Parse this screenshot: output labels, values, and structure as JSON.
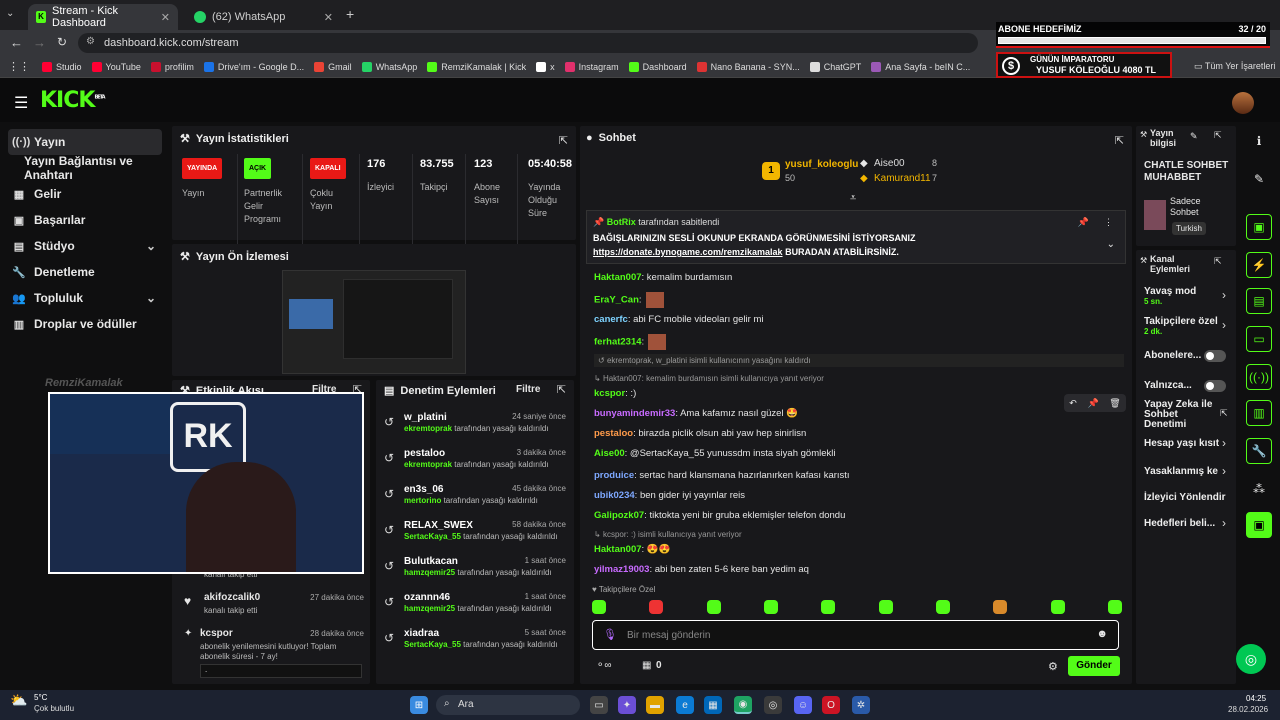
{
  "browser": {
    "tabs": [
      {
        "label": "Stream - Kick Dashboard"
      },
      {
        "label": "(62) WhatsApp"
      }
    ],
    "url": "dashboard.kick.com/stream",
    "bookmarks": [
      "Studio",
      "YouTube",
      "profilim",
      "Drive'ım - Google D...",
      "Gmail",
      "WhatsApp",
      "RemziKamalak | Kick",
      "x",
      "Instagram",
      "Dashboard",
      "Nano Banana - SYN...",
      "ChatGPT",
      "Ana Sayfa - beIN C..."
    ],
    "all_bookmarks": "Tüm Yer İşaretleri"
  },
  "overlay": {
    "goal_title": "ABONE HEDEFİMİZ",
    "goal_count": "32 / 20",
    "goal_progress": 1.0,
    "emperor_title": "GÜNÜN İMPARATORU",
    "emperor_value": "YUSUF KÖLEOĞLU 4080 TL"
  },
  "kick": {
    "logo": "KICK",
    "beta": "BETA"
  },
  "sidebar": {
    "items": [
      {
        "label": "Yayın"
      },
      {
        "label": "Yayın Bağlantısı ve Anahtarı"
      },
      {
        "label": "Gelir"
      },
      {
        "label": "Başarılar"
      },
      {
        "label": "Stüdyo"
      },
      {
        "label": "Denetleme"
      },
      {
        "label": "Topluluk"
      },
      {
        "label": "Droplar ve ödüller"
      }
    ]
  },
  "stats": {
    "title": "Yayın İstatistikleri",
    "items": [
      {
        "badge": "YAYINDA",
        "label": "Yayın"
      },
      {
        "badge": "AÇIK",
        "label": "Partnerlik Gelir Programı"
      },
      {
        "badge": "KAPALI",
        "label": "Çoklu Yayın"
      },
      {
        "value": "176",
        "label": "İzleyici"
      },
      {
        "value": "83.755",
        "label": "Takipçi"
      },
      {
        "value": "123",
        "label": "Abone Sayısı"
      },
      {
        "value": "05:40:58",
        "label": "Yayında Olduğu Süre"
      }
    ]
  },
  "preview": {
    "title": "Yayın Ön İzlemesi"
  },
  "webcam_name": "RemziKamalak",
  "activity": {
    "title": "Etkinlik Akışı",
    "filter": "Filtre",
    "items": [
      {
        "sub": "kanalı takip etti"
      },
      {
        "user": "akifozcalik0",
        "time": "27 dakika önce",
        "sub": "kanalı takip etti"
      },
      {
        "user": "kcspor",
        "time": "28 dakika önce",
        "sub": "abonelik yenilemesini kutluyor! Toplam abonelik süresi - 7 ay!",
        "extra": "."
      }
    ]
  },
  "modlog": {
    "title": "Denetim Eylemleri",
    "filter": "Filtre",
    "items": [
      {
        "user": "w_platini",
        "time": "24 saniye önce",
        "by": "ekremtoprak",
        "desc": "tarafından yasağı kaldırıldı"
      },
      {
        "user": "pestaloo",
        "time": "3 dakika önce",
        "by": "ekremtoprak",
        "desc": "tarafından yasağı kaldırıldı"
      },
      {
        "user": "en3s_06",
        "time": "45 dakika önce",
        "by": "mertorino",
        "desc": "tarafından yasağı kaldırıldı"
      },
      {
        "user": "RELAX_SWEX",
        "time": "58 dakika önce",
        "by": "SertacKaya_55",
        "desc": "tarafından yasağı kaldırıldı"
      },
      {
        "user": "Bulutkacan",
        "time": "1 saat önce",
        "by": "hamzqemir25",
        "desc": "tarafından yasağı kaldırıldı"
      },
      {
        "user": "ozannn46",
        "time": "1 saat önce",
        "by": "hamzqemir25",
        "desc": "tarafından yasağı kaldırıldı"
      },
      {
        "user": "xiadraa",
        "time": "5 saat önce",
        "by": "SertacKaya_55",
        "desc": "tarafından yasağı kaldırıldı"
      }
    ]
  },
  "chat": {
    "title": "Sohbet",
    "top": [
      {
        "name": "yusuf_koleoglu",
        "count": "50",
        "rank": "1"
      },
      {
        "name": "Aise00",
        "count": "8"
      },
      {
        "name": "Kamurand11",
        "count": "7"
      }
    ],
    "pinned_by": "tarafından sabitlendi",
    "pinned_user": "BotRix",
    "pinned_text1": "BAĞIŞLARINIZIN SESLİ OKUNUP EKRANDA GÖRÜNMESİNİ İSTİYORSANIZ",
    "pinned_link": "https://donate.bynogame.com/remzikamalak",
    "pinned_text2": " BURADAN ATABİLİRSİNİZ.",
    "messages": [
      {
        "user": "Haktan007",
        "text": ": kemalim burdamısın",
        "color": "#53fc18"
      },
      {
        "user": "EraY_Can",
        "text": ":",
        "color": "#53fc18"
      },
      {
        "user": "canerfc",
        "text": ": abi FC mobile videoları gelir mi",
        "color": "#7ed3ff"
      },
      {
        "user": "ferhat2314",
        "text": ":",
        "color": "#53fc18"
      },
      {
        "sys": "ekremtoprak, w_platini isimli kullanıcının yasağını kaldırdı"
      },
      {
        "reply": "Haktan007: kemalim burdamısın isimli kullanıcıya yanıt veriyor"
      },
      {
        "user": "kcspor",
        "text": ": :)",
        "color": "#53fc18"
      },
      {
        "user": "bunyamindemir33",
        "text": ": Ama kafamız nasıl güzel 🤩",
        "color": "#c86bff"
      },
      {
        "user": "pestaloo",
        "text": ": birazda piclik olsun abi yaw hep sinirlisn",
        "color": "#ff9b4a"
      },
      {
        "user": "Aise00",
        "text": ": @SertacKaya_55 yunussdm insta siyah gömlekli",
        "color": "#53fc18"
      },
      {
        "user": "produice",
        "text": ": sertac hard klansmana hazırlanırken kafası karıstı",
        "color": "#7ea8ff"
      },
      {
        "user": "ubik0234",
        "text": ": ben gider iyi yayınlar reis",
        "color": "#7ea8ff"
      },
      {
        "user": "Galipozk07",
        "text": ": tiktokta yeni bir gruba eklemişler telefon dondu",
        "color": "#53fc18"
      },
      {
        "reply": "kcspor: :) isimli kullanıcıya yanıt veriyor"
      },
      {
        "user": "Haktan007",
        "text": ": 😍😍",
        "color": "#53fc18"
      },
      {
        "user": "yilmaz19003",
        "text": ": abi ben zaten 5-6 kere ban yedim aq",
        "color": "#c86bff"
      }
    ],
    "followers_only": "Takipçilere Özel",
    "input_placeholder": "Bir mesaj gönderin",
    "points": "0",
    "send": "Gönder"
  },
  "info": {
    "title": "Yayın bilgisi",
    "stream_title": "CHATLE SOHBET MUHABBET",
    "category": "Sadece Sohbet",
    "language": "Turkish"
  },
  "actions": {
    "title": "Kanal Eylemleri",
    "items": [
      {
        "label": "Yavaş mod",
        "sub": "5 sn."
      },
      {
        "label": "Takipçilere özel",
        "sub": "2 dk."
      },
      {
        "label": "Abonelere..."
      },
      {
        "label": "Yalnızca..."
      },
      {
        "label": "Yapay Zeka ile Sohbet Denetimi"
      },
      {
        "label": "Hesap yaşı kısıt"
      },
      {
        "label": "Yasaklanmış ke"
      },
      {
        "label": "İzleyici Yönlendir"
      },
      {
        "label": "Hedefleri beli..."
      }
    ]
  },
  "taskbar": {
    "weather_temp": "5°C",
    "weather_desc": "Çok bulutlu",
    "search": "Ara",
    "time": "04:25",
    "date": "28.02.2026"
  },
  "colors": {
    "kick_green": "#53fc18",
    "panel": "#18181b",
    "live_red": "#e91916"
  }
}
